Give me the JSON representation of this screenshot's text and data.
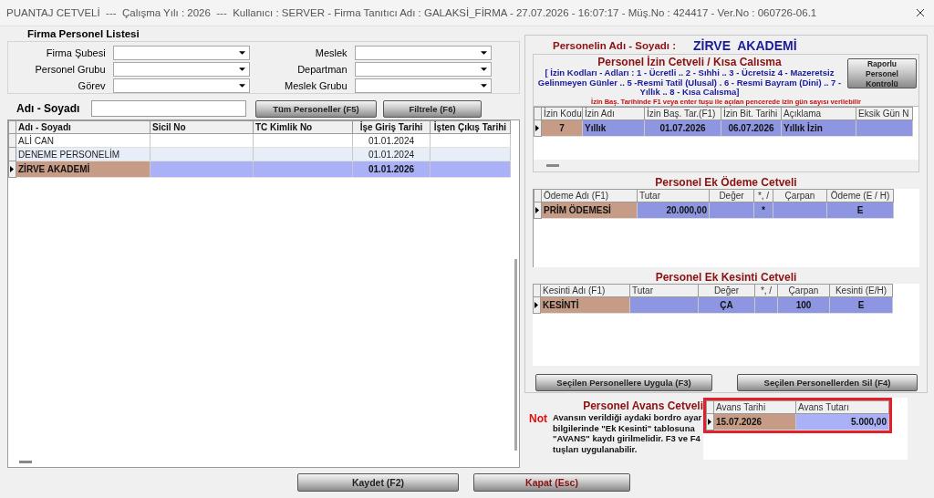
{
  "window": {
    "title": "PUANTAJ CETVELİ  ---  Çalışma Yılı : 2026  ---  Kullanıcı : SERVER - Firma Tanıtıcı Adı : GALAKSİ_FİRMA - 27.07.2026 - 16:07:17 - Müş.No : 424417 - Ver.No : 060726-06.1"
  },
  "left": {
    "title": "Firma Personel Listesi",
    "filters": [
      {
        "label": "Firma Şubesi"
      },
      {
        "label": "Meslek"
      },
      {
        "label": "Personel Grubu"
      },
      {
        "label": "Departman"
      },
      {
        "label": "Görev"
      },
      {
        "label": "Meslek Grubu"
      }
    ],
    "search": {
      "label": "Adı - Soyadı"
    },
    "buttons": [
      "Tüm Personeller (F5)",
      "Filtrele (F6)"
    ],
    "table": {
      "columns": [
        "Adı - Soyadı",
        "Sicil No",
        "TC Kimlik No",
        "İşe Giriş Tarihi",
        "İşten Çıkış Tarihi"
      ],
      "rows": [
        {
          "cells": [
            "ALİ CAN",
            null,
            null,
            "01.01.2024",
            null
          ],
          "selected": false
        },
        {
          "cells": [
            "DENEME PERSONELİM",
            null,
            null,
            "01.01.2024",
            null
          ],
          "selected": false
        },
        {
          "cells": [
            "ZİRVE  AKADEMİ",
            null,
            null,
            "01.01.2026",
            null
          ],
          "selected": true
        }
      ]
    }
  },
  "person": {
    "label": "Personelin Adı - Soyadı :",
    "name": "ZİRVE  AKADEMİ"
  },
  "leave": {
    "title": "Personel İzin Cetveli / Kısa Calısma",
    "legend": "[ İzin Kodları - Adları :  1 - Ücretli .. 2 - Sıhhi  .. 3 - Ücretsiz   4 - Mazeretsiz Gelinmeyen Günler .. 5 -Resmi Tatil  (Ulusal) . 6 - Resmi Bayram (Dini) .. 7 - Yıllık .. 8 - Kısa Calısma]",
    "report_button": "Raporlu Personel Kontrolü",
    "hint": "İzin Baş. Tarihinde F1 veya enter tuşu ile açılan pencerede izin gün sayısı verilebilir",
    "table": {
      "columns": [
        "İzin Kodu",
        "İzin Adı",
        "İzin Baş. Tar.(F1)",
        "İzin Bit. Tarihi",
        "Açıklama",
        "Eksik Gün N"
      ],
      "rows": [
        {
          "cells": [
            "7",
            "Yıllık",
            "01.07.2026",
            "06.07.2026",
            "Yıllık İzin",
            null
          ],
          "selected": true
        }
      ]
    }
  },
  "payments": {
    "title": "Personel Ek Ödeme Cetveli",
    "table": {
      "columns": [
        "Ödeme Adı (F1)",
        "Tutar",
        "Değer",
        "*, /",
        "Çarpan",
        "Ödeme (E / H)"
      ],
      "rows": [
        {
          "cells": [
            "PRİM ÖDEMESİ",
            "20.000,00",
            null,
            "*",
            null,
            "E"
          ],
          "selected": true
        }
      ]
    }
  },
  "deductions": {
    "title": "Personel Ek Kesinti Cetveli",
    "table": {
      "columns": [
        "Kesinti Adı (F1)",
        "Tutar",
        "Değer",
        "*, /",
        "Çarpan",
        "Kesinti (E/H)"
      ],
      "rows": [
        {
          "cells": [
            "KESİNTİ",
            null,
            "ÇA",
            null,
            "100",
            "E"
          ],
          "selected": true
        }
      ]
    }
  },
  "apply_buttons": [
    "Seçilen Personellere Uygula (F3)",
    "Seçilen Personellerden Sil (F4)"
  ],
  "advance": {
    "title": "Personel Avans Cetveli",
    "note_label": "Not",
    "note": "Avansın verildiği aydaki bordro ayar bilgilerinde \"Ek Kesinti\" tablosuna \"AVANS\" kaydı girilmelidir. F3 ve F4 tuşları uygulanabilir.",
    "table": {
      "columns": [
        "Avans Tarihi",
        "Avans Tutarı"
      ],
      "rows": [
        {
          "cells": [
            "15.07.2026",
            "5.000,00"
          ],
          "selected": true
        }
      ]
    }
  },
  "footer_buttons": [
    {
      "label": "Kaydet (F2)",
      "kind": "save"
    },
    {
      "label": "Kapat (Esc)",
      "kind": "close"
    }
  ]
}
